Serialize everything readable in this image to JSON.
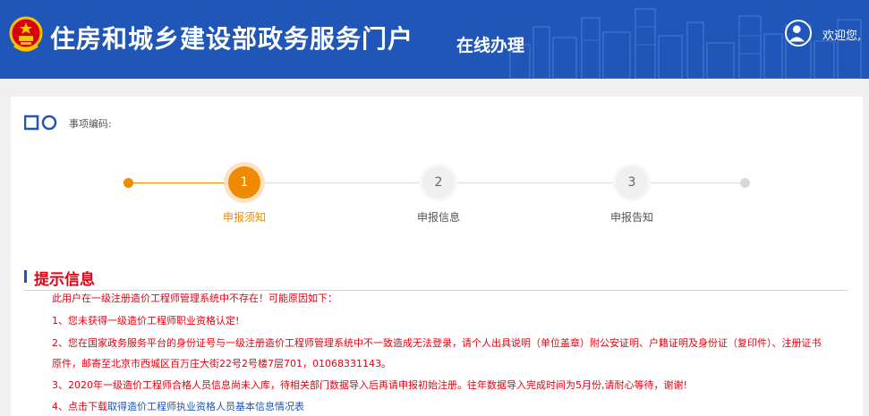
{
  "header": {
    "site_title": "住房和城乡建设部政务服务门户",
    "section_title": "在线办理",
    "welcome": "欢迎您,"
  },
  "item": {
    "code_label": "事项编码:"
  },
  "steps": [
    {
      "number": "1",
      "label": "申报须知",
      "active": true
    },
    {
      "number": "2",
      "label": "申报信息",
      "active": false
    },
    {
      "number": "3",
      "label": "申报告知",
      "active": false
    }
  ],
  "tips": {
    "title": "提示信息",
    "intro": "此用户在一级注册造价工程师管理系统中不存在！可能原因如下：",
    "line1": "1、您未获得一级造价工程师职业资格认定!",
    "line2a": "2、您在国家政务服务平台的身份证号与一级注册造价工程师管理系统中不一致造成无法登录，请个人出具说明（单位盖章）附公安证明、户籍证明及身份证（复印件）、注册证书",
    "line2b": "原件，邮寄至北京市西城区百万庄大街22号2号楼7层701，01068331143。",
    "line3": "3、2020年一级造价工程师合格人员信息尚未入库，待相关部门数据导入后再请申报初始注册。往年数据导入完成时间为5月份,请耐心等待，谢谢!",
    "line4_prefix": "4、点击下载",
    "line4_link": "取得造价工程师执业资格人员基本信息情况表"
  },
  "colors": {
    "header_bg": "#1f56b8",
    "accent": "#f08a00",
    "tip_red": "#e60012"
  }
}
